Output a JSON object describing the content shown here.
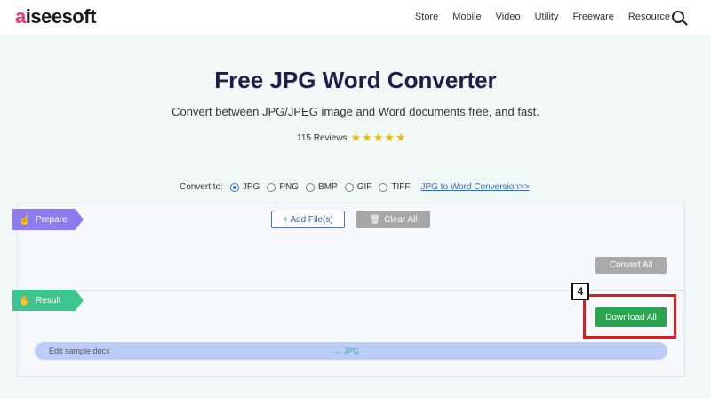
{
  "header": {
    "logo": "aiseesoft",
    "nav": [
      "Store",
      "Mobile",
      "Video",
      "Utility",
      "Freeware",
      "Resource"
    ],
    "search_icon": "search-icon"
  },
  "hero": {
    "title": "Free JPG Word Converter",
    "subtitle": "Convert between JPG/JPEG image and Word documents free, and fast.",
    "reviews": "115 Reviews",
    "stars": "★★★★★"
  },
  "convert": {
    "label": "Convert to:",
    "options": [
      "JPG",
      "PNG",
      "BMP",
      "GIF",
      "TIFF"
    ],
    "selected": "JPG",
    "link": "JPG to Word Conversion>>"
  },
  "prepare": {
    "label": "Prepare",
    "add_files": "+ Add File(s)",
    "clear_all": "Clear All",
    "convert_all": "Convert All"
  },
  "result": {
    "label": "Result",
    "download_all": "Download All",
    "step_number": "4",
    "file_name": "Edit sample.docx",
    "file_format": "→ JPG"
  },
  "colors": {
    "prepare_tag": "#8d7cf0",
    "result_tag": "#3cc58e",
    "download_button": "#2aa44f",
    "highlight": "#d41f24"
  }
}
